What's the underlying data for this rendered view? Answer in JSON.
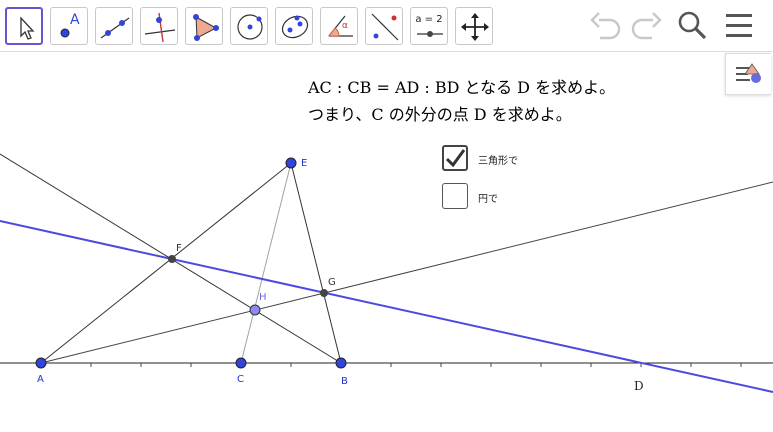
{
  "toolbar": {
    "tools": [
      {
        "name": "move-tool",
        "active": true
      },
      {
        "name": "point-tool",
        "label": "A"
      },
      {
        "name": "line-tool"
      },
      {
        "name": "perpendicular-line-tool"
      },
      {
        "name": "polygon-tool"
      },
      {
        "name": "circle-center-point-tool"
      },
      {
        "name": "conic-tool"
      },
      {
        "name": "angle-tool",
        "label": "α"
      },
      {
        "name": "reflect-tool"
      },
      {
        "name": "slider-tool",
        "label": "a = 2"
      },
      {
        "name": "move-graphics-view-tool"
      }
    ],
    "icons": [
      "undo-icon",
      "redo-icon",
      "search-icon",
      "menu-icon",
      "style-bar-icon"
    ]
  },
  "text": {
    "line1": "AC : CB = AD : BD となる D を求めよ。",
    "line2": "つまり、C の外分の点 D を求めよ。"
  },
  "checkboxes": [
    {
      "label": "三角形で",
      "checked": true
    },
    {
      "label": "円で",
      "checked": false
    }
  ],
  "points": {
    "A": "A",
    "B": "B",
    "C": "C",
    "D": "D",
    "E": "E",
    "F": "F",
    "G": "G",
    "H": "H"
  },
  "colors": {
    "accent": "#6557d2",
    "point": "#3344dd",
    "point_dark": "#444444",
    "line_blue": "#4a4ae0",
    "line_black": "#333333",
    "line_gray": "#a0a0a0",
    "label_blue": "#2233cc"
  }
}
